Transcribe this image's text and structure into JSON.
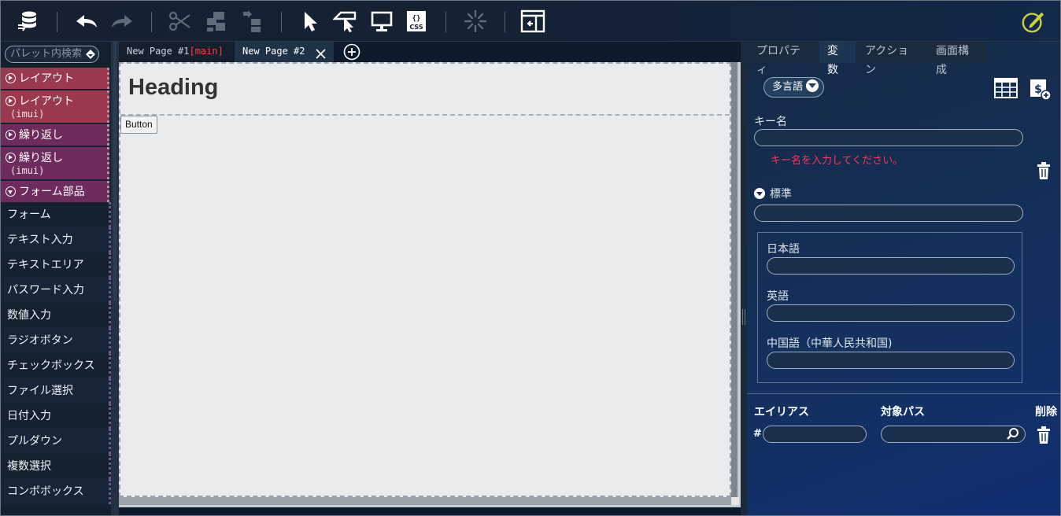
{
  "toolbar": {
    "icons": [
      "database-icon",
      "undo-icon",
      "redo-icon",
      "cut-icon",
      "group-icon",
      "ungroup-icon",
      "select-cursor-icon",
      "event-cursor-icon",
      "preview-monitor-icon",
      "css-icon",
      "loading-icon",
      "panel-toggle-icon",
      "edit-pen-icon"
    ],
    "css_label": "CSS"
  },
  "palette": {
    "search_placeholder": "パレット内検索",
    "categories": [
      {
        "label": "レイアウト",
        "sub": "",
        "color": "#9b3a4f"
      },
      {
        "label": "レイアウト",
        "sub": "(imui)",
        "color": "#9b3a4f"
      },
      {
        "label": "繰り返し",
        "sub": "",
        "color": "#6d2c5c"
      },
      {
        "label": "繰り返し",
        "sub": "(imui)",
        "color": "#6d2c5c"
      },
      {
        "label": "フォーム部品",
        "sub": "",
        "color": "#6d2c5c"
      }
    ],
    "items": [
      "フォーム",
      "テキスト入力",
      "テキストエリア",
      "パスワード入力",
      "数値入力",
      "ラジオボタン",
      "チェックボックス",
      "ファイル選択",
      "日付入力",
      "プルダウン",
      "複数選択",
      "コンボボックス"
    ]
  },
  "tabs": {
    "tab1_label": "New Page #1",
    "tab1_tag": "[main]",
    "tab2_label": "New Page #2"
  },
  "canvas": {
    "heading": "Heading",
    "button_label": "Button"
  },
  "rpanel": {
    "tabs": [
      "プロパティ",
      "変数",
      "アクション",
      "画面構成"
    ],
    "active_tab": "変数",
    "multilang_label": "多言語",
    "key_label": "キー名",
    "key_value": "",
    "key_error": "キー名を入力してください。",
    "standard_label": "標準",
    "standard_value": "",
    "japanese_label": "日本語",
    "english_label": "英語",
    "chinese_label": "中国語（中華人民共和国)",
    "alias_header": "エイリアス",
    "target_path_header": "対象パス",
    "delete_header": "削除",
    "hash_label": "#"
  }
}
